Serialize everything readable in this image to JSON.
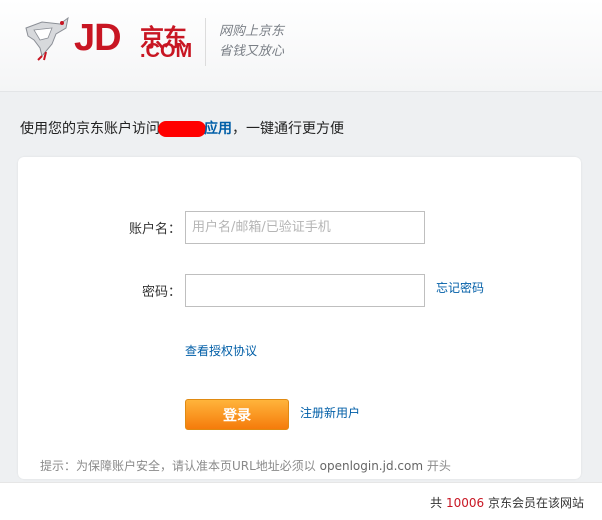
{
  "header": {
    "logo_jd": "JD",
    "logo_cn": "京东",
    "logo_com": ".COM",
    "slogan_line1": "网购上京东",
    "slogan_line2": "省钱又放心"
  },
  "intro": {
    "prefix": "使用您的京东账户访问",
    "app_name": "应用",
    "suffix": "，一键通行更方便"
  },
  "form": {
    "account_label": "账户名：",
    "account_placeholder": "用户名/邮箱/已验证手机",
    "password_label": "密码：",
    "password_value": "",
    "forgot_password": "忘记密码",
    "view_agreement": "查看授权协议",
    "login_button": "登录",
    "register_link": "注册新用户"
  },
  "hint": {
    "text": "提示：为保障账户安全，请认准本页URL地址必须以 ",
    "domain": "openlogin.jd.com",
    "suffix": " 开头"
  },
  "footer": {
    "prefix": "共 ",
    "count": "10006",
    "suffix": " 京东会员在该网站"
  },
  "colors": {
    "brand_red": "#c81623",
    "link_blue": "#005ea7",
    "button_orange": "#f57b0b",
    "redaction": "#ff0000"
  }
}
